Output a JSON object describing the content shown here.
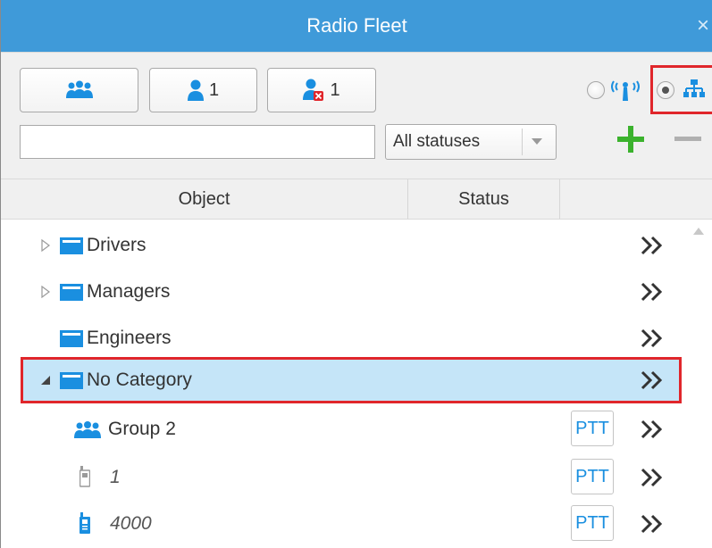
{
  "window": {
    "title": "Radio Fleet",
    "close_glyph": "×"
  },
  "toolbar": {
    "buttons": [
      {
        "icon": "group-icon",
        "count": ""
      },
      {
        "icon": "user-icon",
        "count": "1"
      },
      {
        "icon": "user-offline-icon",
        "count": "1"
      }
    ],
    "search": {
      "value": "",
      "placeholder": ""
    },
    "status_filter": {
      "selected": "All statuses"
    },
    "view_modes": [
      {
        "icon": "radio-signal-icon",
        "selected": false
      },
      {
        "icon": "hierarchy-icon",
        "selected": true
      }
    ],
    "add_icon": "plus-icon",
    "remove_icon": "minus-icon"
  },
  "table": {
    "columns": [
      "Object",
      "Status"
    ],
    "rows": [
      {
        "label": "Drivers",
        "type": "folder",
        "expandable": true
      },
      {
        "label": "Managers",
        "type": "folder",
        "expandable": true
      },
      {
        "label": "Engineers",
        "type": "folder",
        "expandable": false
      },
      {
        "label": "No Category",
        "type": "folder",
        "expanded": true,
        "selected": true
      },
      {
        "label": "Group 2",
        "type": "group",
        "action": "PTT"
      },
      {
        "label": "1",
        "type": "radio-offline",
        "action": "PTT"
      },
      {
        "label": "4000",
        "type": "radio-online",
        "action": "PTT"
      }
    ]
  },
  "colors": {
    "accent": "#3f9ad9",
    "selection": "#c5e5f8",
    "highlight": "#e0262b",
    "add": "#3bb22d"
  }
}
